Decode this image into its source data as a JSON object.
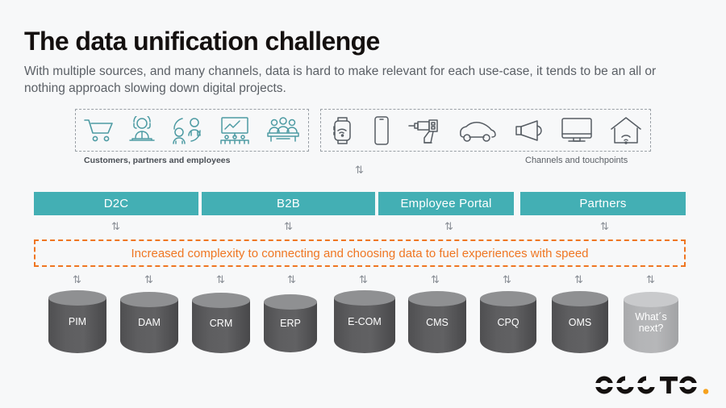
{
  "page": {
    "title": "The data unification challenge",
    "subtitle": "With multiple sources, and many channels, data is hard to make relevant for each use-case, it tends to be an all or nothing approach slowing down digital projects.",
    "background_color": "#f7f8f9"
  },
  "groups": {
    "left": {
      "label": "Customers, partners and employees",
      "border_style": "dashed",
      "icon_color": "#4d9ba3",
      "icons": [
        {
          "name": "shopping-cart-icon"
        },
        {
          "name": "support-agent-icon"
        },
        {
          "name": "people-exchange-icon"
        },
        {
          "name": "presentation-board-icon"
        },
        {
          "name": "meeting-table-icon"
        }
      ]
    },
    "right": {
      "label": "Channels and touchpoints",
      "border_style": "dashed",
      "icon_color": "#565c63",
      "icons": [
        {
          "name": "smartwatch-icon"
        },
        {
          "name": "smartphone-icon"
        },
        {
          "name": "power-drill-icon"
        },
        {
          "name": "car-icon"
        },
        {
          "name": "megaphone-icon"
        },
        {
          "name": "desktop-monitor-icon"
        },
        {
          "name": "smart-home-icon"
        }
      ]
    }
  },
  "channels": {
    "color": "#43afb4",
    "text_color": "#ffffff",
    "bars": [
      {
        "label": "D2C"
      },
      {
        "label": "B2B"
      },
      {
        "label": "Employee Portal"
      },
      {
        "label": "Partners"
      }
    ]
  },
  "complexity": {
    "text": "Increased complexity to connecting and choosing data to fuel experiences with speed",
    "color": "#ef7622",
    "border_style": "dashed"
  },
  "systems": {
    "default_color": "#5b5b5d",
    "highlight_color": "#b0b1b3",
    "items": [
      {
        "label": "PIM",
        "variant": "dark"
      },
      {
        "label": "DAM",
        "variant": "dark"
      },
      {
        "label": "CRM",
        "variant": "dark"
      },
      {
        "label": "ERP",
        "variant": "dark"
      },
      {
        "label": "E-COM",
        "variant": "dark"
      },
      {
        "label": "CMS",
        "variant": "dark"
      },
      {
        "label": "CPQ",
        "variant": "dark"
      },
      {
        "label": "OMS",
        "variant": "dark"
      },
      {
        "label": "What´s next?",
        "variant": "light"
      }
    ]
  },
  "arrows": {
    "glyph": "⇅",
    "color": "#8a8f96",
    "count_top": 1,
    "count_mid": 4,
    "count_bottom": 9
  },
  "logo": {
    "text": "occtoo",
    "dot_color": "#f6a21e",
    "text_color": "#14100f"
  }
}
